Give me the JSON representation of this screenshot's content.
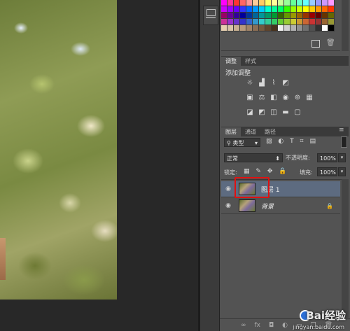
{
  "swatches": {
    "colors": [
      "#ff00ff",
      "#ff3399",
      "#ff3333",
      "#ff6666",
      "#ff9999",
      "#ffcc99",
      "#ffcc66",
      "#ffff66",
      "#ffff99",
      "#ccff99",
      "#99ff99",
      "#66ff99",
      "#66ffcc",
      "#66ffff",
      "#99ccff",
      "#9999ff",
      "#cc99ff",
      "#ff99ff",
      "#cc00ff",
      "#9900ff",
      "#6600ff",
      "#3333ff",
      "#0066ff",
      "#0099ff",
      "#00ccff",
      "#00ffcc",
      "#00ff99",
      "#00ff66",
      "#33ff00",
      "#99ff00",
      "#ccff00",
      "#ffff00",
      "#ffcc00",
      "#ff9900",
      "#ff6600",
      "#ff3300",
      "#990066",
      "#660099",
      "#330099",
      "#000099",
      "#003399",
      "#006699",
      "#009999",
      "#009966",
      "#009933",
      "#336600",
      "#669900",
      "#999900",
      "#996600",
      "#993300",
      "#990000",
      "#660000",
      "#663300",
      "#666600",
      "#cc3399",
      "#9933cc",
      "#6633cc",
      "#3333cc",
      "#3366cc",
      "#3399cc",
      "#33cccc",
      "#33cc99",
      "#33cc66",
      "#66cc33",
      "#99cc33",
      "#cccc33",
      "#cc9933",
      "#cc6633",
      "#cc3333",
      "#993333",
      "#996633",
      "#999933",
      "#e6d0b0",
      "#d8c4a8",
      "#c8b092",
      "#b89a7c",
      "#a08468",
      "#8a6e54",
      "#74583e",
      "#5e442c",
      "#48321c",
      "#f0f0f0",
      "#d0d0d0",
      "#b0b0b0",
      "#909090",
      "#707070",
      "#505050",
      "#303030",
      "#ffffff",
      "#000000"
    ]
  },
  "adjustments": {
    "tabs": [
      "调整",
      "样式"
    ],
    "active_tab": "调整",
    "title": "添加调整",
    "icons": [
      [
        "brightness-icon",
        "levels-icon",
        "curves-icon",
        "exposure-icon"
      ],
      [
        "vibrance-icon",
        "hue-saturation-icon",
        "color-balance-icon",
        "black-white-icon",
        "photo-filter-icon",
        "channel-mixer-icon",
        "color-lookup-icon"
      ],
      [
        "invert-icon",
        "posterize-icon",
        "threshold-icon",
        "gradient-map-icon",
        "selective-color-icon"
      ]
    ]
  },
  "layers": {
    "tabs": [
      "图层",
      "通道",
      "路径"
    ],
    "active_tab": "图层",
    "filter_label": "类型",
    "blend_mode": "正常",
    "opacity_label": "不透明度:",
    "opacity_value": "100%",
    "lock_label": "锁定:",
    "fill_label": "填充:",
    "fill_value": "100%",
    "items": [
      {
        "name": "图层 1",
        "selected": true
      },
      {
        "name": "背景",
        "selected": false,
        "locked": true
      }
    ],
    "highlight_color": "#e01010",
    "selected_row_color": "#5d6b80"
  },
  "bottom_icons": [
    "link-icon",
    "fx-icon",
    "mask-icon",
    "adjustment-layer-icon",
    "group-icon",
    "new-layer-icon",
    "trash-icon"
  ],
  "bottom_glyphs": [
    "∞",
    "fx",
    "◘",
    "◐",
    "▭",
    "❐",
    "🗑"
  ],
  "watermark": {
    "brand": "Bai经验",
    "url": "jingyan.baidu.com"
  }
}
